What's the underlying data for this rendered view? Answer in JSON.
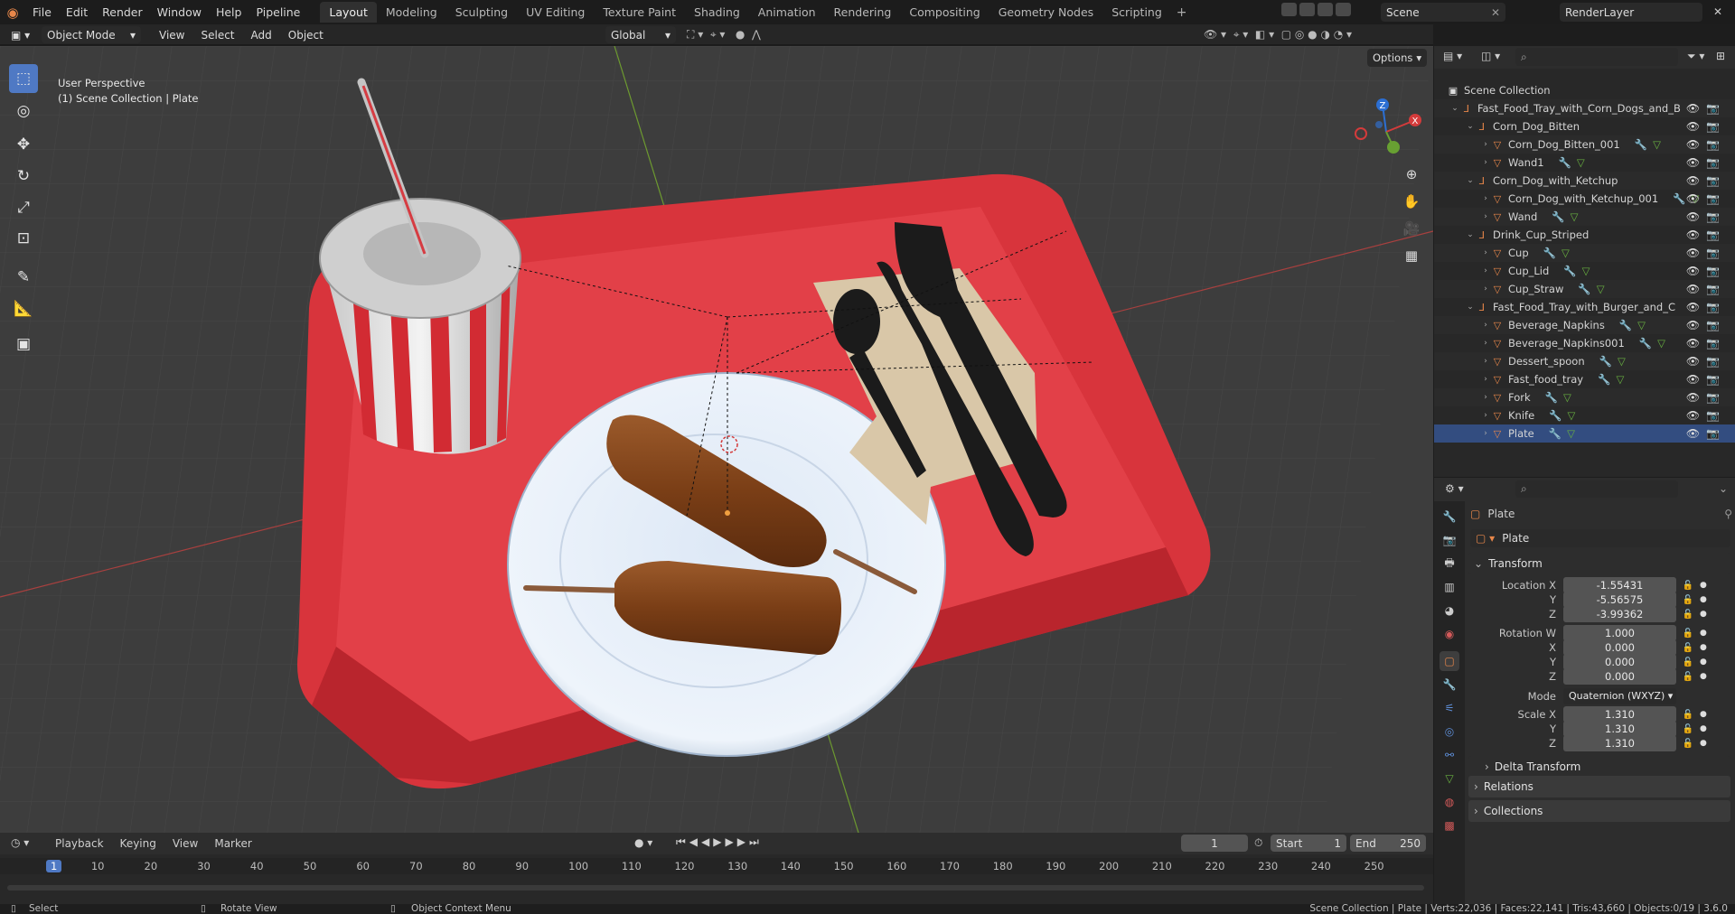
{
  "topbar": {
    "menus": [
      "File",
      "Edit",
      "Render",
      "Window",
      "Help",
      "Pipeline"
    ],
    "workspaces": [
      "Layout",
      "Modeling",
      "Sculpting",
      "UV Editing",
      "Texture Paint",
      "Shading",
      "Animation",
      "Rendering",
      "Compositing",
      "Geometry Nodes",
      "Scripting"
    ],
    "add_tab": "+",
    "scene": "Scene",
    "render_layer": "RenderLayer"
  },
  "viewport_header": {
    "mode": "Object Mode",
    "menus": [
      "View",
      "Select",
      "Add",
      "Object"
    ],
    "orientation": "Global",
    "options": "Options"
  },
  "viewport": {
    "perspective": "User Perspective",
    "context": "(1) Scene Collection | Plate",
    "gizmo": {
      "z": "Z",
      "x": "X"
    }
  },
  "outliner": {
    "root": "Scene Collection",
    "rows": [
      {
        "label": "Fast_Food_Tray_with_Corn_Dogs_and_B",
        "indent": 1,
        "type": "empty",
        "open": true
      },
      {
        "label": "Corn_Dog_Bitten",
        "indent": 2,
        "type": "empty",
        "open": true
      },
      {
        "label": "Corn_Dog_Bitten_001",
        "indent": 3,
        "type": "mesh",
        "open": false
      },
      {
        "label": "Wand1",
        "indent": 3,
        "type": "mesh",
        "open": false
      },
      {
        "label": "Corn_Dog_with_Ketchup",
        "indent": 2,
        "type": "empty",
        "open": true
      },
      {
        "label": "Corn_Dog_with_Ketchup_001",
        "indent": 3,
        "type": "mesh",
        "open": false
      },
      {
        "label": "Wand",
        "indent": 3,
        "type": "mesh",
        "open": false
      },
      {
        "label": "Drink_Cup_Striped",
        "indent": 2,
        "type": "empty",
        "open": true
      },
      {
        "label": "Cup",
        "indent": 3,
        "type": "mesh",
        "open": false
      },
      {
        "label": "Cup_Lid",
        "indent": 3,
        "type": "mesh",
        "open": false
      },
      {
        "label": "Cup_Straw",
        "indent": 3,
        "type": "mesh",
        "open": false
      },
      {
        "label": "Fast_Food_Tray_with_Burger_and_C",
        "indent": 2,
        "type": "empty",
        "open": true
      },
      {
        "label": "Beverage_Napkins",
        "indent": 3,
        "type": "mesh",
        "open": false
      },
      {
        "label": "Beverage_Napkins001",
        "indent": 3,
        "type": "mesh",
        "open": false
      },
      {
        "label": "Dessert_spoon",
        "indent": 3,
        "type": "mesh",
        "open": false
      },
      {
        "label": "Fast_food_tray",
        "indent": 3,
        "type": "mesh",
        "open": false
      },
      {
        "label": "Fork",
        "indent": 3,
        "type": "mesh",
        "open": false
      },
      {
        "label": "Knife",
        "indent": 3,
        "type": "mesh",
        "open": false
      },
      {
        "label": "Plate",
        "indent": 3,
        "type": "mesh",
        "open": false,
        "selected": true
      }
    ]
  },
  "properties": {
    "object_name": "Plate",
    "data_name": "Plate",
    "transform_label": "Transform",
    "location": {
      "label": "Location X",
      "x": "-1.55431",
      "y": "-5.56575",
      "z": "-3.99362"
    },
    "rotation": {
      "label": "Rotation W",
      "w": "1.000",
      "x": "0.000",
      "y": "0.000",
      "z": "0.000"
    },
    "axis": {
      "x": "X",
      "y": "Y",
      "z": "Z"
    },
    "mode_label": "Mode",
    "mode_value": "Quaternion (WXYZ)",
    "scale": {
      "label": "Scale X",
      "x": "1.310",
      "y": "1.310",
      "z": "1.310"
    },
    "delta_transform": "Delta Transform",
    "relations": "Relations",
    "collections": "Collections"
  },
  "timeline": {
    "menus": [
      "Playback",
      "Keying",
      "View",
      "Marker"
    ],
    "current_frame": "1",
    "start_label": "Start",
    "start": "1",
    "end_label": "End",
    "end": "250",
    "ticks": [
      "1",
      "10",
      "20",
      "30",
      "40",
      "50",
      "60",
      "70",
      "80",
      "90",
      "100",
      "110",
      "120",
      "130",
      "140",
      "150",
      "160",
      "170",
      "180",
      "190",
      "200",
      "210",
      "220",
      "230",
      "240",
      "250"
    ]
  },
  "statusbar": {
    "select": "Select",
    "rotate": "Rotate View",
    "context_menu": "Object Context Menu",
    "stats": "Scene Collection | Plate | Verts:22,036 | Faces:22,141 | Tris:43,660 | Objects:0/19 | 3.6.0"
  },
  "colors": {
    "accent": "#4f79c4",
    "tray_red": "#e03a40",
    "mesh_orange": "#e8874a",
    "selected_row": "#334d80"
  }
}
